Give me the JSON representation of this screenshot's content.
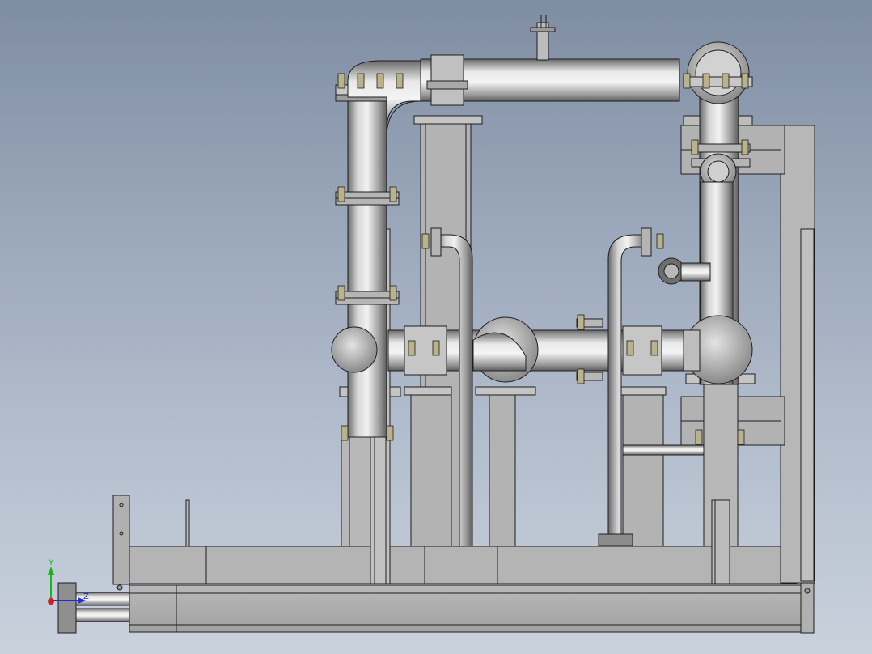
{
  "view": {
    "background_top": "#7f8da3",
    "background_bottom": "#c9d1dc",
    "model_color": "#a9a9a9",
    "edge_color": "#1e1e1e"
  },
  "triad": {
    "x_label": "",
    "y_label": "Y",
    "z_label": "Z",
    "y_color": "#1db31d",
    "z_color": "#1c2fd6",
    "x_color": "#d61c1c"
  }
}
